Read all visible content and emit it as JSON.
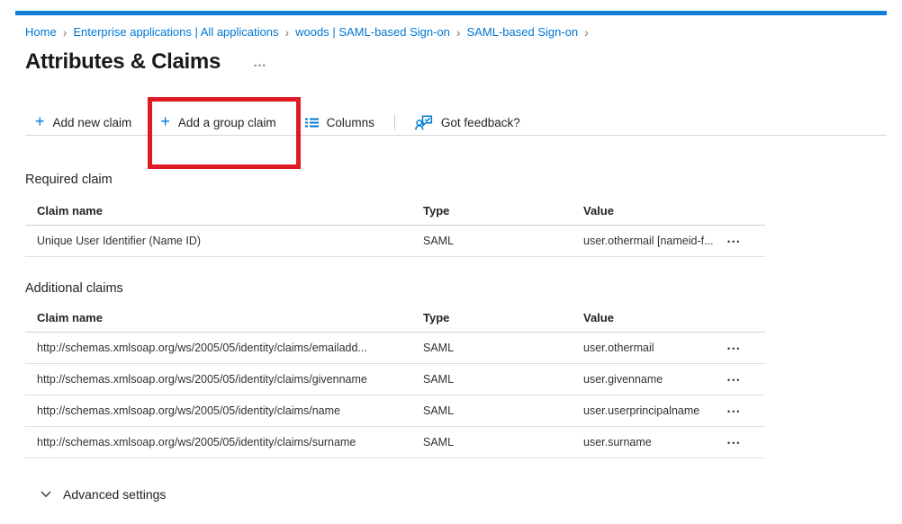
{
  "breadcrumb": {
    "items": [
      "Home",
      "Enterprise applications | All applications",
      "woods | SAML-based Sign-on",
      "SAML-based Sign-on"
    ]
  },
  "header": {
    "title": "Attributes & Claims"
  },
  "toolbar": {
    "add_new_claim_label": "Add new claim",
    "add_group_claim_label": "Add a group claim",
    "columns_label": "Columns",
    "feedback_label": "Got feedback?"
  },
  "tables": {
    "required": {
      "section_label": "Required claim",
      "headers": {
        "claim_name": "Claim name",
        "type": "Type",
        "value": "Value"
      },
      "rows": [
        {
          "claim_name": "Unique User Identifier (Name ID)",
          "type": "SAML",
          "value": "user.othermail [nameid-f..."
        }
      ]
    },
    "additional": {
      "section_label": "Additional claims",
      "headers": {
        "claim_name": "Claim name",
        "type": "Type",
        "value": "Value"
      },
      "rows": [
        {
          "claim_name": "http://schemas.xmlsoap.org/ws/2005/05/identity/claims/emailadd...",
          "type": "SAML",
          "value": "user.othermail"
        },
        {
          "claim_name": "http://schemas.xmlsoap.org/ws/2005/05/identity/claims/givenname",
          "type": "SAML",
          "value": "user.givenname"
        },
        {
          "claim_name": "http://schemas.xmlsoap.org/ws/2005/05/identity/claims/name",
          "type": "SAML",
          "value": "user.userprincipalname"
        },
        {
          "claim_name": "http://schemas.xmlsoap.org/ws/2005/05/identity/claims/surname",
          "type": "SAML",
          "value": "user.surname"
        }
      ]
    }
  },
  "advanced_settings": {
    "label": "Advanced settings"
  },
  "icons": {
    "plus": "+",
    "more_options": "•••",
    "title_more": "…",
    "breadcrumb_separator": "›"
  },
  "colors": {
    "accent_blue": "#0078d4",
    "top_bar_blue": "#0f7fdb",
    "annotation_red": "#e01b24",
    "title_text": "#1b1a19",
    "divider_grey": "#e1dfdd"
  }
}
